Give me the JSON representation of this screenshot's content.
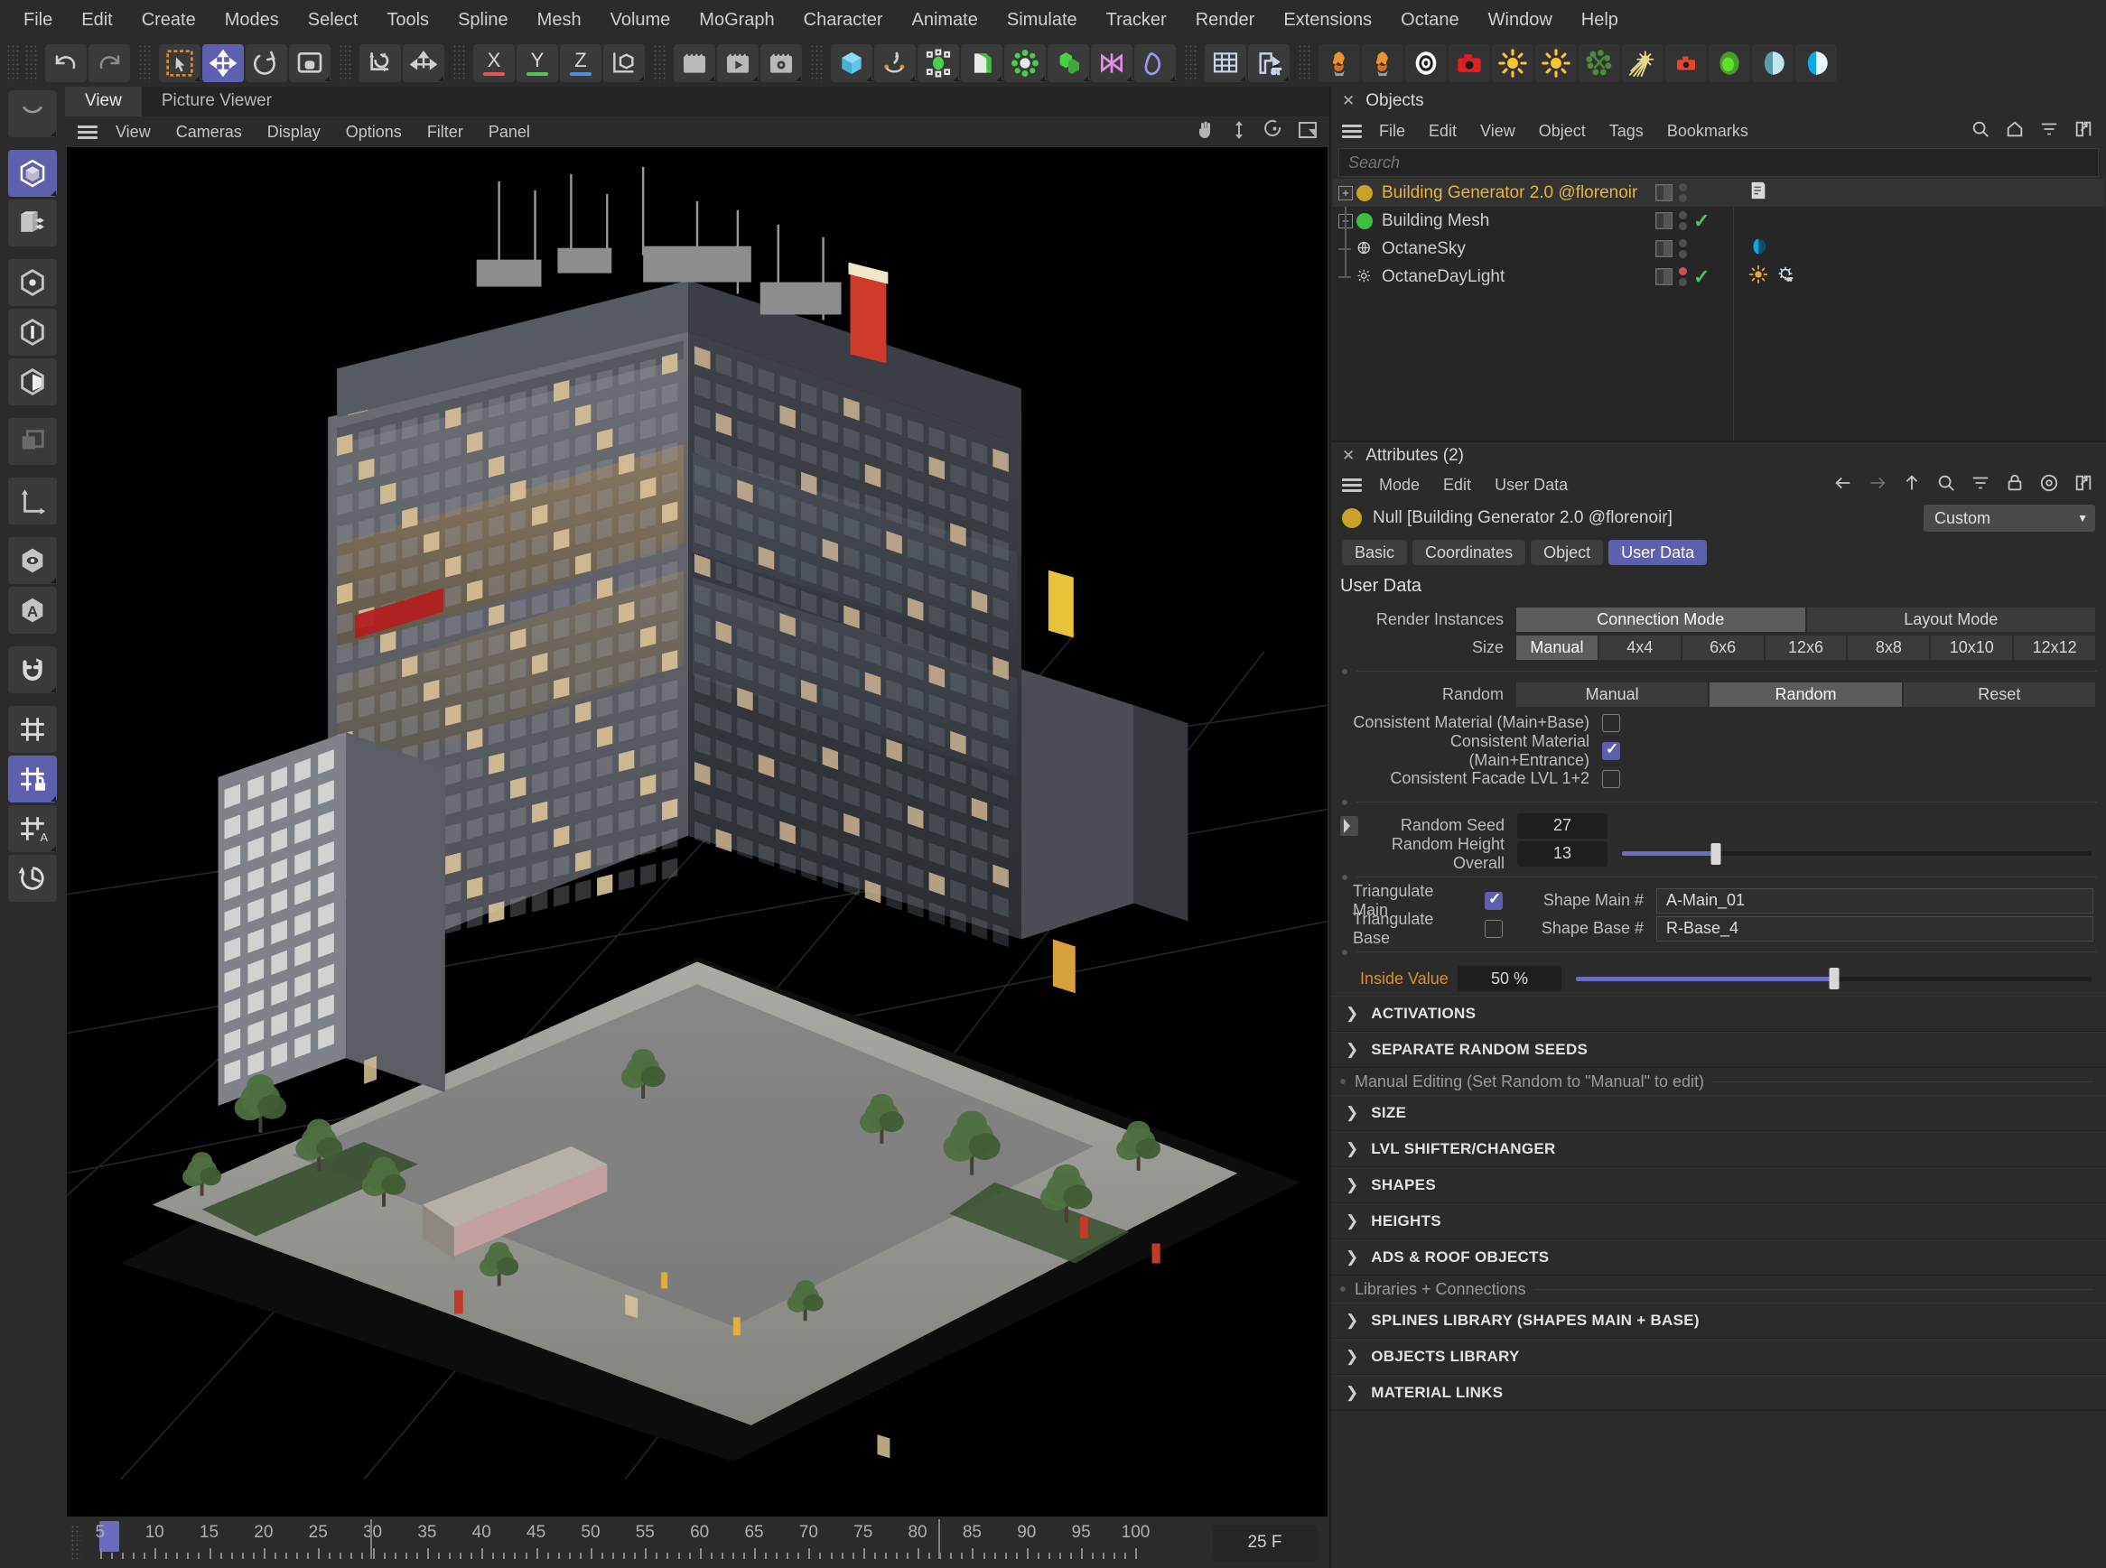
{
  "menubar": {
    "items": [
      "File",
      "Edit",
      "Create",
      "Modes",
      "Select",
      "Tools",
      "Spline",
      "Mesh",
      "Volume",
      "MoGraph",
      "Character",
      "Animate",
      "Simulate",
      "Tracker",
      "Render",
      "Extensions",
      "Octane",
      "Window",
      "Help"
    ]
  },
  "toolbar": {
    "groups": [
      {
        "name": "undo-redo",
        "buttons": [
          {
            "icon": "undo-icon",
            "label": "Undo"
          },
          {
            "icon": "redo-icon",
            "label": "Redo"
          }
        ]
      },
      {
        "name": "transform-tools",
        "buttons": [
          {
            "icon": "select-icon",
            "label": "Live Selection"
          },
          {
            "icon": "move-icon",
            "label": "Move",
            "selected": true
          },
          {
            "icon": "rotate-icon",
            "label": "Rotate"
          },
          {
            "icon": "scale-icon",
            "label": "Scale"
          },
          {
            "icon": "world-object-axis-icon",
            "label": "Object/World Axis"
          },
          {
            "icon": "enable-axis-icon",
            "label": "Enable Axis Modification"
          }
        ]
      },
      {
        "name": "axis-locks",
        "buttons": [
          {
            "icon": "x-axis-icon",
            "label": "X",
            "color": "#e05a5a"
          },
          {
            "icon": "y-axis-icon",
            "label": "Y",
            "color": "#55c25a"
          },
          {
            "icon": "z-axis-icon",
            "label": "Z",
            "color": "#4f8fe0"
          },
          {
            "icon": "world-coordinates-icon",
            "label": "World Coordinate System"
          }
        ]
      },
      {
        "name": "render-tools",
        "buttons": [
          {
            "icon": "render-view-icon",
            "label": "Render View"
          },
          {
            "icon": "render-picture-viewer-icon",
            "label": "Render to Picture Viewer"
          },
          {
            "icon": "render-settings-icon",
            "label": "Render Settings"
          }
        ]
      },
      {
        "name": "create-tools",
        "buttons": [
          {
            "icon": "cube-primitive-icon",
            "label": "Cube"
          },
          {
            "icon": "spline-pen-icon",
            "label": "Spline Pen"
          },
          {
            "icon": "nurbs-icon",
            "label": "Generators"
          },
          {
            "icon": "array-icon",
            "label": "Array"
          },
          {
            "icon": "deformer-icon",
            "label": "Bend Deformer"
          },
          {
            "icon": "scene-environment-icon",
            "label": "Environment"
          },
          {
            "icon": "camera-object-icon",
            "label": "Camera"
          },
          {
            "icon": "light-object-icon",
            "label": "Light"
          }
        ]
      },
      {
        "name": "view-tools",
        "buttons": [
          {
            "icon": "grid-icon",
            "label": "Grid"
          },
          {
            "icon": "snap-icon",
            "label": "Snap"
          }
        ]
      },
      {
        "name": "octane-tools",
        "buttons": [
          {
            "icon": "octane-render-icon",
            "label": "Octane Render"
          },
          {
            "icon": "octane-render-2-icon",
            "label": "Octane Render Viewport"
          },
          {
            "icon": "octane-settings-icon",
            "label": "Octane Settings"
          },
          {
            "icon": "octane-camera-icon",
            "label": "Octane Camera"
          },
          {
            "icon": "octane-daylight-icon",
            "label": "Octane Daylight"
          },
          {
            "icon": "octane-sun-icon",
            "label": "Octane Sun"
          },
          {
            "icon": "octane-scatter-icon",
            "label": "Octane Scatter"
          },
          {
            "icon": "octane-sunlight-icon",
            "label": "Octane Sunlight"
          },
          {
            "icon": "octane-camera-target-icon",
            "label": "Octane Camera Target"
          },
          {
            "icon": "octane-sphere-icon",
            "label": "Octane Object Tag"
          },
          {
            "icon": "octane-material-icon",
            "label": "Octane Material"
          },
          {
            "icon": "octane-material-2-icon",
            "label": "Octane Node Editor"
          }
        ]
      }
    ]
  },
  "left_toolbar": {
    "items": [
      {
        "icon": "model-mode-icon",
        "label": "Model Mode",
        "selected": true
      },
      {
        "icon": "object-mode-icon",
        "label": "Object Mode"
      },
      {
        "icon": "point-mode-icon",
        "label": "Points Mode"
      },
      {
        "icon": "edge-mode-icon",
        "label": "Edges Mode"
      },
      {
        "icon": "polygon-mode-icon",
        "label": "Polygons Mode"
      },
      {
        "icon": "texture-mode-icon",
        "label": "Texture Mode"
      },
      {
        "icon": "axis-mode-icon",
        "label": "Workplane"
      },
      {
        "icon": "viewport-solo-icon",
        "label": "Viewport Solo"
      },
      {
        "icon": "enable-axis-letter-icon",
        "label": "Enable Axis Modification"
      },
      {
        "icon": "magnet-icon",
        "label": "Magnet"
      },
      {
        "icon": "workplane-icon",
        "label": "Workplane"
      },
      {
        "icon": "workplane-lock-icon",
        "label": "Lock Workplane",
        "selected": true
      },
      {
        "icon": "workplane-auto-icon",
        "label": "Automatic Workplane"
      },
      {
        "icon": "reset-workplane-icon",
        "label": "Reset Workplane"
      }
    ]
  },
  "viewport": {
    "tabs": [
      {
        "label": "View",
        "active": true
      },
      {
        "label": "Picture Viewer",
        "active": false
      }
    ],
    "menu": [
      "View",
      "Cameras",
      "Display",
      "Options",
      "Filter",
      "Panel"
    ],
    "corner_icons": [
      "pan-icon",
      "zoom-icon",
      "rotate-view-icon",
      "maximize-viewport-icon"
    ]
  },
  "timeline": {
    "ticks": [
      5,
      10,
      15,
      20,
      25,
      30,
      35,
      40,
      45,
      50,
      55,
      60,
      65,
      70,
      75,
      80,
      85,
      90,
      95,
      100
    ],
    "current_frame_label": "25 F",
    "playhead_frame": 5,
    "range_start": 5,
    "range_end": 100
  },
  "objects_panel": {
    "title": "Objects",
    "close_label": "✕",
    "menu": [
      "File",
      "Edit",
      "View",
      "Object",
      "Tags",
      "Bookmarks"
    ],
    "header_icons": [
      "search-icon",
      "home-icon",
      "filter-icon",
      "open-window-icon"
    ],
    "search_placeholder": "Search",
    "rows": [
      {
        "name": "Building Generator 2.0 @florenoir",
        "icon_color": "#c9a227",
        "selected": true,
        "expandable": true,
        "has_check": false,
        "dot_red": false,
        "tags": [
          "note-tag-icon"
        ]
      },
      {
        "name": "Building Mesh",
        "icon_color": "#3fbf3f",
        "selected": false,
        "expandable": true,
        "has_check": true,
        "dot_red": false,
        "tags": []
      },
      {
        "name": "OctaneSky",
        "icon_color": "#8d8d8d",
        "selected": false,
        "expandable": false,
        "has_check": false,
        "dot_red": false,
        "tags": [
          "octane-sky-tag-icon"
        ]
      },
      {
        "name": "OctaneDayLight",
        "icon_color": "#8d8d8d",
        "selected": false,
        "expandable": false,
        "has_check": true,
        "dot_red": true,
        "tags": [
          "octane-sun-tag-icon",
          "octane-object-tag-icon"
        ]
      }
    ]
  },
  "attributes_panel": {
    "title": "Attributes (2)",
    "close_label": "✕",
    "menu": [
      "Mode",
      "Edit",
      "User Data"
    ],
    "header_icons": [
      "back-arrow-icon",
      "forward-arrow-icon",
      "up-arrow-icon",
      "search-icon",
      "filter-icon",
      "lock-icon",
      "target-icon",
      "open-window-icon"
    ],
    "object_line": "Null [Building Generator 2.0 @florenoir]",
    "object_icon_color": "#c9a227",
    "dropdown_value": "Custom",
    "tabs": [
      {
        "label": "Basic",
        "selected": false
      },
      {
        "label": "Coordinates",
        "selected": false
      },
      {
        "label": "Object",
        "selected": false
      },
      {
        "label": "User Data",
        "selected": true
      }
    ],
    "section_title": "User Data",
    "render_instances": {
      "label": "Render Instances",
      "options": [
        {
          "label": "Connection Mode",
          "selected": true
        },
        {
          "label": "Layout Mode",
          "selected": false
        }
      ]
    },
    "size": {
      "label": "Size",
      "options": [
        {
          "label": "Manual",
          "selected": true
        },
        {
          "label": "4x4",
          "selected": false
        },
        {
          "label": "6x6",
          "selected": false
        },
        {
          "label": "12x6",
          "selected": false
        },
        {
          "label": "8x8",
          "selected": false
        },
        {
          "label": "10x10",
          "selected": false
        },
        {
          "label": "12x12",
          "selected": false
        }
      ]
    },
    "random": {
      "label": "Random",
      "options": [
        {
          "label": "Manual",
          "selected": false
        },
        {
          "label": "Random",
          "selected": true
        },
        {
          "label": "Reset",
          "selected": false
        }
      ]
    },
    "checkboxes": [
      {
        "label": "Consistent Material (Main+Base)",
        "checked": false
      },
      {
        "label": "Consistent Material (Main+Entrance)",
        "checked": true
      },
      {
        "label": "Consistent Facade LVL 1+2",
        "checked": false
      }
    ],
    "random_seed": {
      "label": "Random Seed",
      "value": "27"
    },
    "random_height": {
      "label": "Random Height Overall",
      "value": "13",
      "percent": 20
    },
    "triangulate_main": {
      "label": "Triangulate Main",
      "checked": true
    },
    "triangulate_base": {
      "label": "Triangulate Base",
      "checked": false
    },
    "shape_main": {
      "label": "Shape Main #",
      "value": "A-Main_01"
    },
    "shape_base": {
      "label": "Shape Base #",
      "value": "R-Base_4"
    },
    "inside_value": {
      "label": "Inside Value",
      "value": "50 %",
      "percent": 50
    },
    "sections_a": [
      "ACTIVATIONS",
      "SEPARATE RANDOM SEEDS"
    ],
    "group_manual": "Manual Editing (Set Random to \"Manual\" to edit)",
    "sections_b": [
      "SIZE",
      "LVL SHIFTER/CHANGER",
      "SHAPES",
      "HEIGHTS",
      "ADS & ROOF OBJECTS"
    ],
    "group_libraries": "Libraries + Connections",
    "sections_c": [
      "SPLINES LIBRARY (SHAPES MAIN + BASE)",
      "OBJECTS LIBRARY",
      "MATERIAL LINKS"
    ]
  },
  "colors": {
    "accent": "#5f5fb0",
    "selected_object": "#e8b33a",
    "inside_value_label": "#e08c2a",
    "panel_bg": "#2b2b2b",
    "check_green": "#4fc25a"
  }
}
